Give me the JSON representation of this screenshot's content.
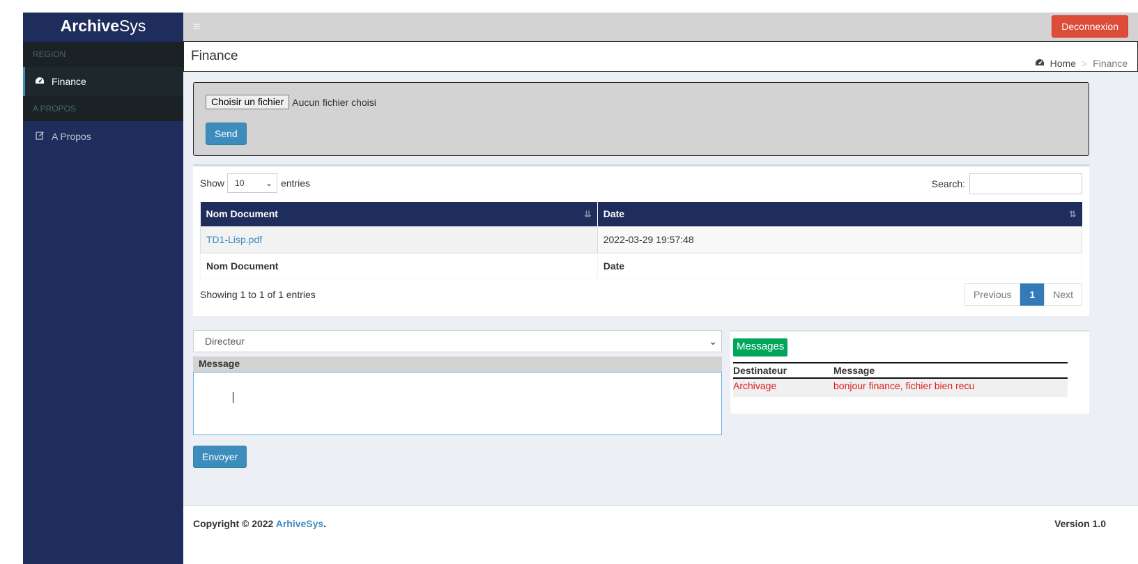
{
  "app": {
    "brand_bold": "Archive",
    "brand_rest": "Sys"
  },
  "sidebar": {
    "sections": [
      {
        "header": "REGION",
        "items": [
          {
            "label": "Finance",
            "icon": "dashboard-icon",
            "active": true
          }
        ]
      },
      {
        "header": "A PROPOS",
        "items": [
          {
            "label": "A Propos",
            "icon": "edit-icon",
            "active": false
          }
        ]
      }
    ]
  },
  "topbar": {
    "menu_icon": "hamburger-icon",
    "logout_label": "Deconnexion"
  },
  "header": {
    "title": "Finance",
    "breadcrumb_home": "Home",
    "breadcrumb_current": "Finance"
  },
  "upload": {
    "file_button_label": "Choisir un fichier",
    "file_status": "Aucun fichier choisi",
    "send_label": "Send"
  },
  "table": {
    "show_label": "Show",
    "entries_value": "10",
    "entries_label": "entries",
    "search_label": "Search:",
    "columns": [
      "Nom Document",
      "Date"
    ],
    "rows": [
      {
        "name": "TD1-Lisp.pdf",
        "date": "2022-03-29 19:57:48"
      }
    ],
    "footer_columns": [
      "Nom Document",
      "Date"
    ],
    "info": "Showing 1 to 1 of 1 entries",
    "pagination": {
      "previous": "Previous",
      "current": "1",
      "next": "Next"
    }
  },
  "compose": {
    "recipient": "Directeur",
    "message_label": "Message",
    "message_value": "",
    "send_label": "Envoyer"
  },
  "messages": {
    "title": "Messages",
    "columns": [
      "Destinateur",
      "Message"
    ],
    "rows": [
      {
        "sender": "Archivage",
        "text": "bonjour finance, fichier bien recu"
      }
    ]
  },
  "footer": {
    "copyright": "Copyright © 2022",
    "brand": "ArhiveSys",
    "dot": ".",
    "version": "Version 1.0"
  },
  "colors": {
    "sidebar": "#1f2d5c",
    "primary": "#3c8dbc",
    "danger": "#dd4b39",
    "success": "#00a65a"
  }
}
